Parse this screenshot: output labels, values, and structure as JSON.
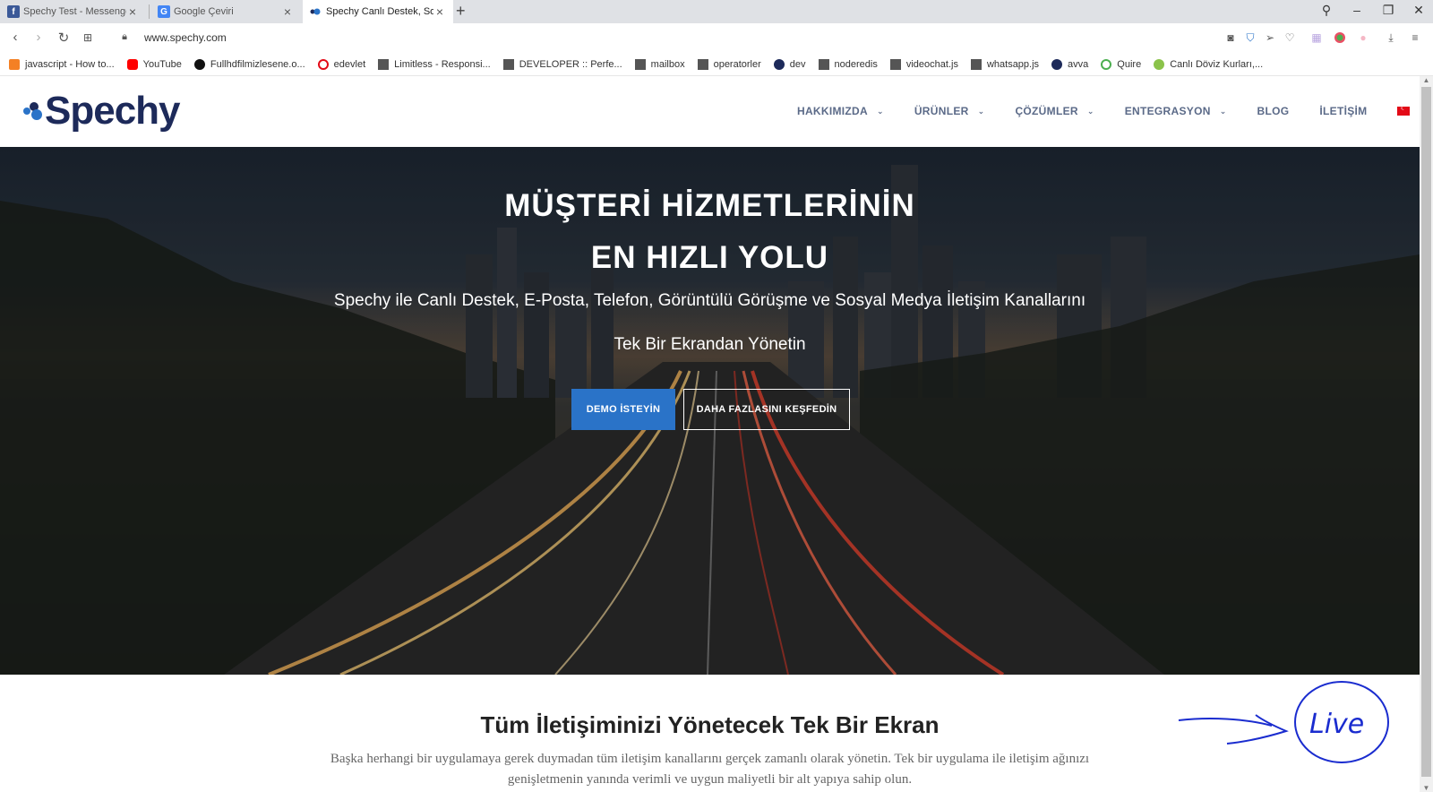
{
  "browser": {
    "tabs": [
      {
        "title": "Spechy Test - Messenger -",
        "favicon": "facebook-icon",
        "color": "#3b5998"
      },
      {
        "title": "Google Çeviri",
        "favicon": "google-translate-icon",
        "color": "#4285f4"
      },
      {
        "title": "Spechy Canlı Destek, Sosya",
        "favicon": "spechy-icon",
        "color": "#1d2a5a"
      }
    ],
    "url": "www.spechy.com",
    "bookmarks": [
      {
        "label": "javascript - How to...",
        "icon": "stackoverflow-icon"
      },
      {
        "label": "YouTube",
        "icon": "youtube-icon"
      },
      {
        "label": "Fullhdfilmizlesene.o...",
        "icon": "film-reel-icon"
      },
      {
        "label": "edevlet",
        "icon": "edevlet-icon"
      },
      {
        "label": "Limitless - Responsi...",
        "icon": "page-icon"
      },
      {
        "label": "DEVELOPER :: Perfe...",
        "icon": "page-icon"
      },
      {
        "label": "mailbox",
        "icon": "page-icon"
      },
      {
        "label": "operatorler",
        "icon": "page-icon"
      },
      {
        "label": "dev",
        "icon": "spechy-icon"
      },
      {
        "label": "noderedis",
        "icon": "page-icon"
      },
      {
        "label": "videochat.js",
        "icon": "page-icon"
      },
      {
        "label": "whatsapp.js",
        "icon": "page-icon"
      },
      {
        "label": "avva",
        "icon": "spechy-icon"
      },
      {
        "label": "Quire",
        "icon": "quire-icon"
      },
      {
        "label": "Canlı Döviz Kurları,...",
        "icon": "currency-icon"
      }
    ]
  },
  "site": {
    "logo": "Spechy",
    "menu": [
      {
        "label": "HAKKIMIZDA",
        "dropdown": true
      },
      {
        "label": "ÜRÜNLER",
        "dropdown": true
      },
      {
        "label": "ÇÖZÜMLER",
        "dropdown": true
      },
      {
        "label": "ENTEGRASYON",
        "dropdown": true
      },
      {
        "label": "BLOG",
        "dropdown": false
      },
      {
        "label": "İLETİŞİM",
        "dropdown": false
      }
    ],
    "hero": {
      "title_line1": "MÜŞTERİ HİZMETLERİNİN",
      "title_line2": "EN HIZLI YOLU",
      "subtitle_line1": "Spechy ile Canlı Destek, E-Posta, Telefon, Görüntülü Görüşme ve Sosyal Medya İletişim Kanallarını",
      "subtitle_line2": "Tek Bir Ekrandan Yönetin",
      "primary_button": "DEMO İSTEYİN",
      "secondary_button": "DAHA FAZLASINI KEŞFEDİN"
    },
    "section": {
      "title": "Tüm İletişiminizi Yönetecek Tek Bir Ekran",
      "text": "Başka herhangi bir uygulamaya gerek duymadan tüm iletişim kanallarını gerçek zamanlı olarak yönetin. Tek bir uygulama ile iletişim ağınızı genişletmenin yanında verimli ve uygun maliyetli bir alt yapıya sahip olun."
    }
  },
  "annotation": {
    "text": "Live",
    "color": "#1a2ccf"
  }
}
